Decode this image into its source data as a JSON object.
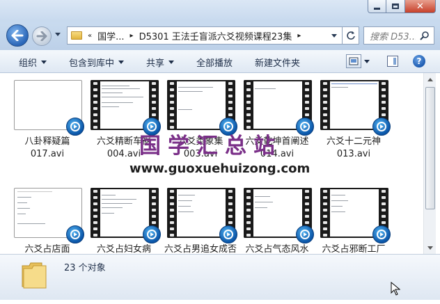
{
  "window": {
    "controls": {
      "minimize": "minimize",
      "maximize": "maximize",
      "close": "✕"
    }
  },
  "nav": {
    "breadcrumb": [
      "«",
      "国学...",
      "▸",
      "D5301 王法壬盲派六爻视频课程23集",
      "▸"
    ],
    "search_placeholder": "搜索 D53...",
    "back_icon": "back-arrow-icon",
    "forward_icon": "forward-arrow-icon"
  },
  "toolbar": {
    "organize": "组织",
    "include_library": "包含到库中",
    "share": "共享",
    "play_all": "全部播放",
    "new_folder": "新建文件夹",
    "help": "?"
  },
  "files": [
    {
      "line1": "八卦释疑篇",
      "line2": "017.avi",
      "style": "plain"
    },
    {
      "line1": "六爻精断车祸",
      "line2": "004.avi",
      "style": "film"
    },
    {
      "line1": "六爻类象集",
      "line2": "003.avi",
      "style": "film"
    },
    {
      "line1": "六爻乾坤首阐述",
      "line2": "014.avi",
      "style": "film"
    },
    {
      "line1": "六爻十二元神",
      "line2": "013.avi",
      "style": "film"
    },
    {
      "line1": "六爻占店面",
      "line2": "",
      "style": "plain"
    },
    {
      "line1": "六爻占妇女病",
      "line2": "",
      "style": "film"
    },
    {
      "line1": "六爻占男追女成否",
      "line2": "",
      "style": "film"
    },
    {
      "line1": "六爻占气态风水",
      "line2": "",
      "style": "film"
    },
    {
      "line1": "六爻占邪断工厂",
      "line2": "",
      "style": "film"
    }
  ],
  "watermark": {
    "chinese": "国学汇总站",
    "url": "www.guoxuehuizong.com"
  },
  "details": {
    "count": "23 个对象"
  },
  "colors": {
    "accent": "#2a66b8",
    "watermark": "#7a2f88",
    "toolbar_text": "#1e2e48"
  }
}
